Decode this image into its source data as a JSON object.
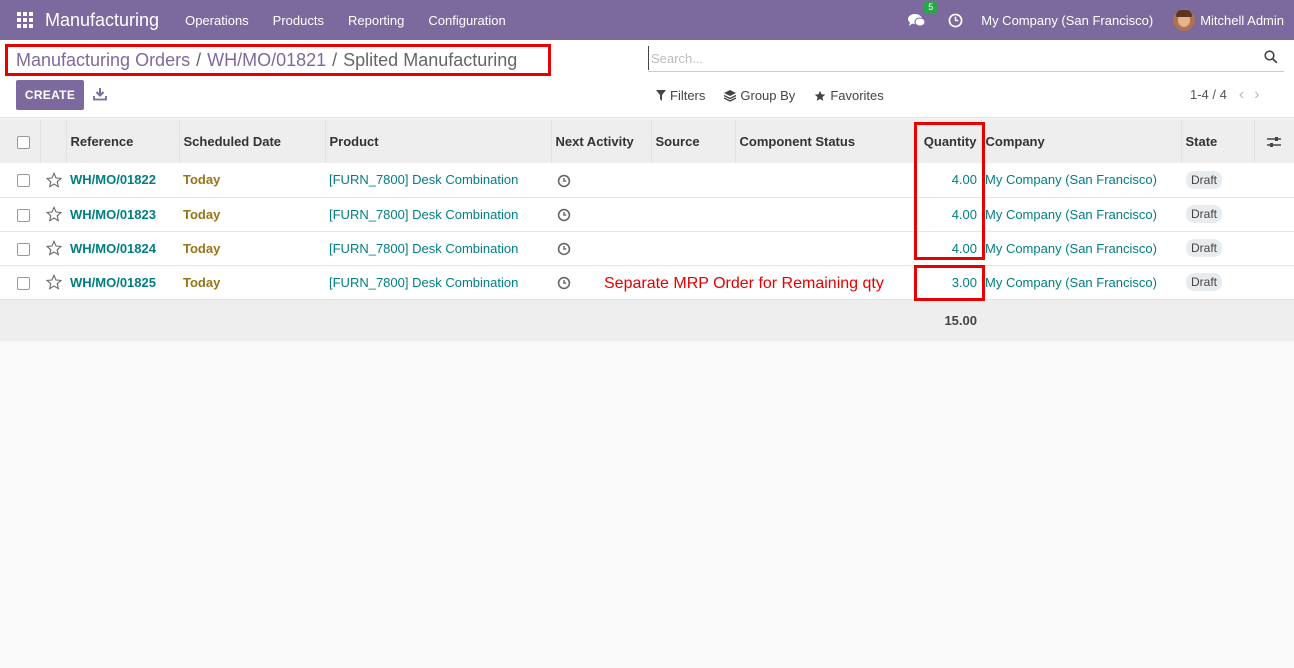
{
  "navbar": {
    "app_name": "Manufacturing",
    "menu": [
      "Operations",
      "Products",
      "Reporting",
      "Configuration"
    ],
    "messages_count": "5",
    "company": "My Company (San Francisco)",
    "user": "Mitchell Admin",
    "bg_color": "#7c6a9e"
  },
  "breadcrumb": {
    "root": "Manufacturing Orders",
    "middle": "WH/MO/01821",
    "current": "Splited Manufacturing",
    "separator": "/"
  },
  "search": {
    "placeholder": "Search..."
  },
  "toolbar": {
    "create_label": "CREATE"
  },
  "filters": {
    "filters_label": "Filters",
    "group_by_label": "Group By",
    "favorites_label": "Favorites"
  },
  "pager": {
    "value": "1-4 / 4",
    "prev": "‹",
    "next": "›"
  },
  "table": {
    "columns": [
      "Reference",
      "Scheduled Date",
      "Product",
      "Next Activity",
      "Source",
      "Component Status",
      "Quantity",
      "Company",
      "State"
    ],
    "rows": [
      {
        "reference": "WH/MO/01822",
        "scheduled": "Today",
        "product": "[FURN_7800] Desk Combination",
        "source": "",
        "component_status": "",
        "quantity": "4.00",
        "company": "My Company (San Francisco)",
        "state": "Draft"
      },
      {
        "reference": "WH/MO/01823",
        "scheduled": "Today",
        "product": "[FURN_7800] Desk Combination",
        "source": "",
        "component_status": "",
        "quantity": "4.00",
        "company": "My Company (San Francisco)",
        "state": "Draft"
      },
      {
        "reference": "WH/MO/01824",
        "scheduled": "Today",
        "product": "[FURN_7800] Desk Combination",
        "source": "",
        "component_status": "",
        "quantity": "4.00",
        "company": "My Company (San Francisco)",
        "state": "Draft"
      },
      {
        "reference": "WH/MO/01825",
        "scheduled": "Today",
        "product": "[FURN_7800] Desk Combination",
        "source": "",
        "component_status": "",
        "quantity": "3.00",
        "company": "My Company (San Francisco)",
        "state": "Draft"
      }
    ],
    "total_quantity": "15.00"
  },
  "annotation": {
    "text": "Separate MRP Order for Remaining qty",
    "color": "#e60000"
  }
}
